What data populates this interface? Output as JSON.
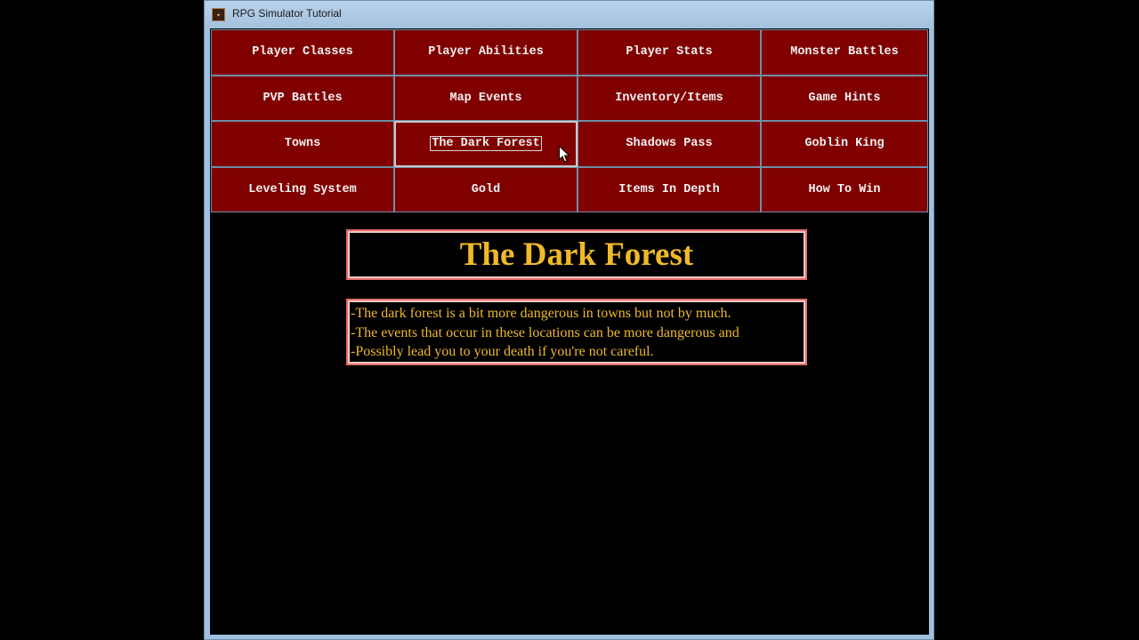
{
  "window": {
    "title": "RPG Simulator Tutorial"
  },
  "nav": {
    "buttons": [
      "Player Classes",
      "Player Abilities",
      "Player Stats",
      "Monster Battles",
      "PVP Battles",
      "Map Events",
      "Inventory/Items",
      "Game Hints",
      "Towns",
      "The Dark Forest",
      "Shadows Pass",
      "Goblin King",
      "Leveling System",
      "Gold",
      "Items In Depth",
      "How To Win"
    ],
    "selected": "The Dark Forest"
  },
  "content": {
    "heading": "The Dark Forest",
    "lines": [
      "-The dark forest is a bit more dangerous in towns but not by much.",
      "-The events that occur in these locations can be more dangerous and",
      "-Possibly lead you to your death if you're not careful."
    ]
  },
  "colors": {
    "button_bg": "#800000",
    "accent_text": "#f0b92b",
    "frame": "#e86a6a"
  },
  "icons": {
    "app": "app-icon",
    "cursor": "mouse-cursor-icon"
  }
}
